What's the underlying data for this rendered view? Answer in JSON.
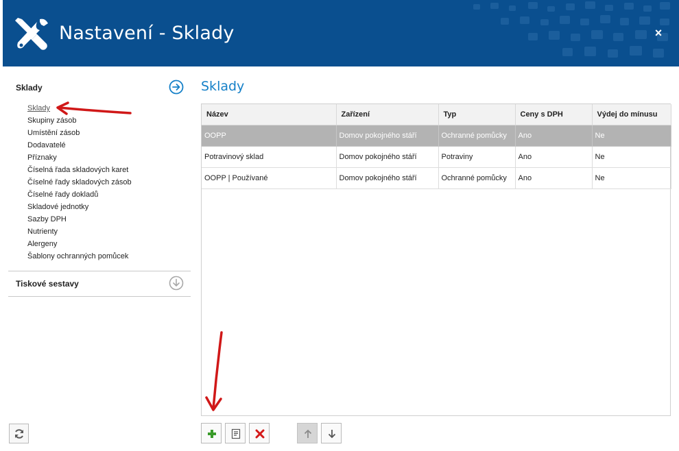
{
  "window": {
    "title": "Nastavení - Sklady",
    "logo_icon": "wrench-screwdriver-icon",
    "close_label": "×",
    "accent_color": "#0a4f8f"
  },
  "sidebar": {
    "sections": [
      {
        "title": "Sklady",
        "icon": "arrow-right-circle-icon",
        "expanded": true,
        "items": [
          {
            "label": "Sklady",
            "active": true
          },
          {
            "label": "Skupiny zásob"
          },
          {
            "label": "Umístění zásob"
          },
          {
            "label": "Dodavatelé"
          },
          {
            "label": "Příznaky"
          },
          {
            "label": "Číselná řada skladových karet"
          },
          {
            "label": "Číselné řady skladových zásob"
          },
          {
            "label": "Číselné řady dokladů"
          },
          {
            "label": "Skladové jednotky"
          },
          {
            "label": "Sazby DPH"
          },
          {
            "label": "Nutrienty"
          },
          {
            "label": "Alergeny"
          },
          {
            "label": "Šablony ochranných pomůcek"
          }
        ]
      },
      {
        "title": "Tiskové sestavy",
        "icon": "arrow-down-circle-icon",
        "expanded": false
      }
    ],
    "refresh_icon": "refresh-icon"
  },
  "main": {
    "title": "Sklady",
    "table": {
      "columns": [
        "Název",
        "Zařízení",
        "Typ",
        "Ceny s DPH",
        "Výdej do mínusu"
      ],
      "rows": [
        {
          "cells": [
            "OOPP",
            "Domov pokojného stáří",
            "Ochranné pomůcky",
            "Ano",
            "Ne"
          ],
          "selected": true
        },
        {
          "cells": [
            "Potravinový sklad",
            "Domov pokojného stáří",
            "Potraviny",
            "Ano",
            "Ne"
          ],
          "selected": false
        },
        {
          "cells": [
            "OOPP | Používané",
            "Domov pokojného stáří",
            "Ochranné pomůcky",
            "Ano",
            "Ne"
          ],
          "selected": false
        }
      ]
    },
    "toolbar": {
      "add_icon": "plus-icon",
      "edit_icon": "edit-document-icon",
      "delete_icon": "delete-x-icon",
      "move_up_icon": "arrow-up-icon",
      "move_down_icon": "arrow-down-icon"
    }
  },
  "annotations": {
    "arrow_color": "#d01818"
  }
}
